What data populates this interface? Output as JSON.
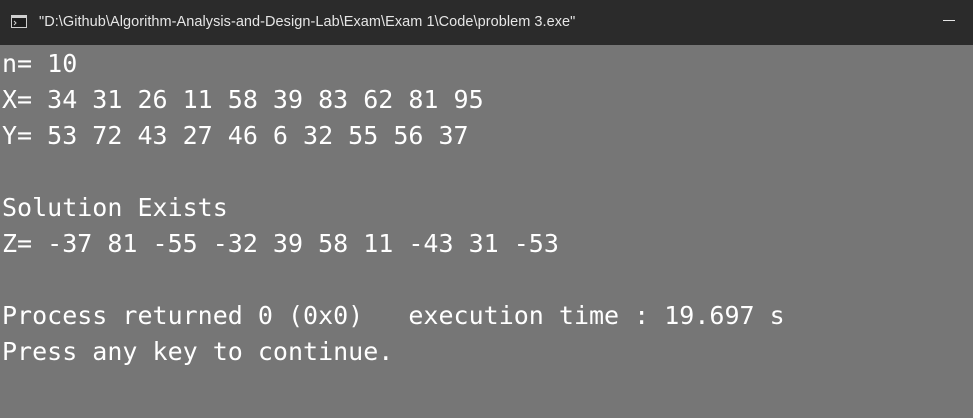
{
  "window": {
    "title": "\"D:\\Github\\Algorithm-Analysis-and-Design-Lab\\Exam\\Exam 1\\Code\\problem 3.exe\"",
    "icon": "console-app-icon",
    "minimize_icon": "minimize-icon"
  },
  "colors": {
    "titlebar_bg": "#2b2b2b",
    "console_bg": "#767676",
    "console_text": "#ffffff"
  },
  "console": {
    "lines": [
      "n= 10",
      "X= 34 31 26 11 58 39 83 62 81 95",
      "Y= 53 72 43 27 46 6 32 55 56 37",
      "",
      "Solution Exists",
      "Z= -37 81 -55 -32 39 58 11 -43 31 -53",
      "",
      "Process returned 0 (0x0)   execution time : 19.697 s",
      "Press any key to continue."
    ]
  }
}
